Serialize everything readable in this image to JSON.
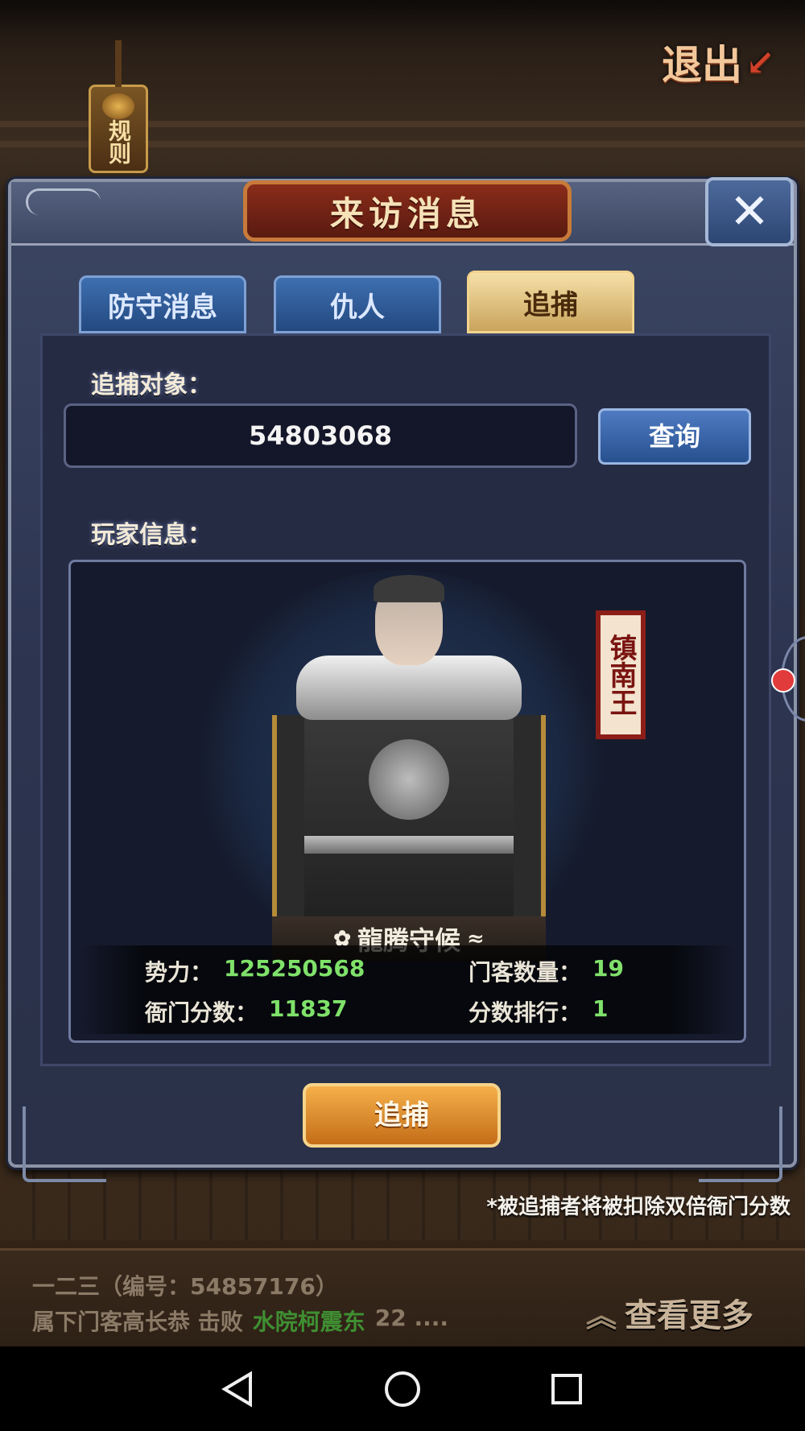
{
  "top": {
    "exit_label": "退出",
    "rules_label": "规则"
  },
  "modal": {
    "title": "来访消息",
    "close_glyph": "✕",
    "tabs": [
      {
        "label": "防守消息",
        "active": false
      },
      {
        "label": "仇人",
        "active": false
      },
      {
        "label": "追捕",
        "active": true
      }
    ]
  },
  "search": {
    "target_label": "追捕对象：",
    "target_value": "54803068",
    "query_label": "查询"
  },
  "player": {
    "section_label": "玩家信息：",
    "title_seal": "镇南王",
    "guild_name": "龍腾守候",
    "stats": {
      "power_label": "势力：",
      "power_value": "125250568",
      "retainers_label": "门客数量：",
      "retainers_value": "19",
      "score_label": "衙门分数：",
      "score_value": "11837",
      "rank_label": "分数排行：",
      "rank_value": "1"
    }
  },
  "action": {
    "pursue_label": "追捕",
    "footnote": "*被追捕者将被扣除双倍衙门分数"
  },
  "log": {
    "line1": "一二三（编号：54857176）",
    "line2_prefix": "属下门客高长恭 击败",
    "line2_name": "水院柯震东",
    "line2_suffix": "22 ....",
    "more_label": "查看更多"
  },
  "icons": {
    "close": "close-icon",
    "back": "back-triangle-icon",
    "home": "home-circle-icon",
    "recents": "recents-square-icon",
    "more": "double-chevron-up-icon"
  },
  "colors": {
    "stat_value": "#7fe16a",
    "pursue_button": "#e38b2c",
    "tab_active": "#e6c47c",
    "tab_inactive": "#2f5b98"
  }
}
